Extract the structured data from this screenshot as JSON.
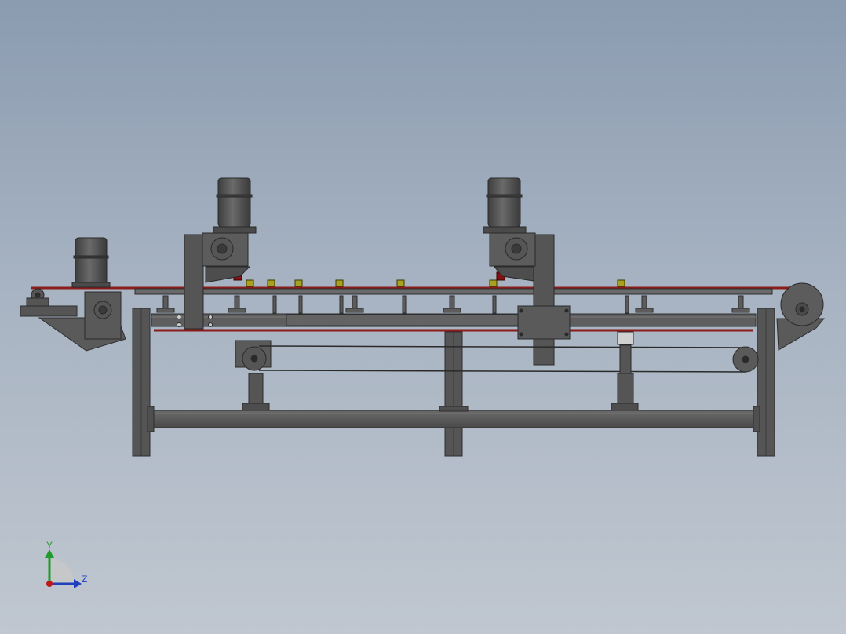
{
  "viewport": {
    "model_name": "",
    "colors": {
      "background_top": "#8b9bb0",
      "background_bottom": "#c0c7d0",
      "steel": "#595959",
      "steel_dark": "#3a3a3a",
      "steel_light": "#7a7a7a",
      "belt_red": "#8a1c1c",
      "roller_yellow": "#a8a020",
      "motor": "#4a4a4a"
    }
  },
  "triad": {
    "y_label": "Y",
    "z_label": "Z",
    "y_color": "#1f9a2b",
    "z_color": "#1f3fbf",
    "x_color": "#c01818"
  }
}
